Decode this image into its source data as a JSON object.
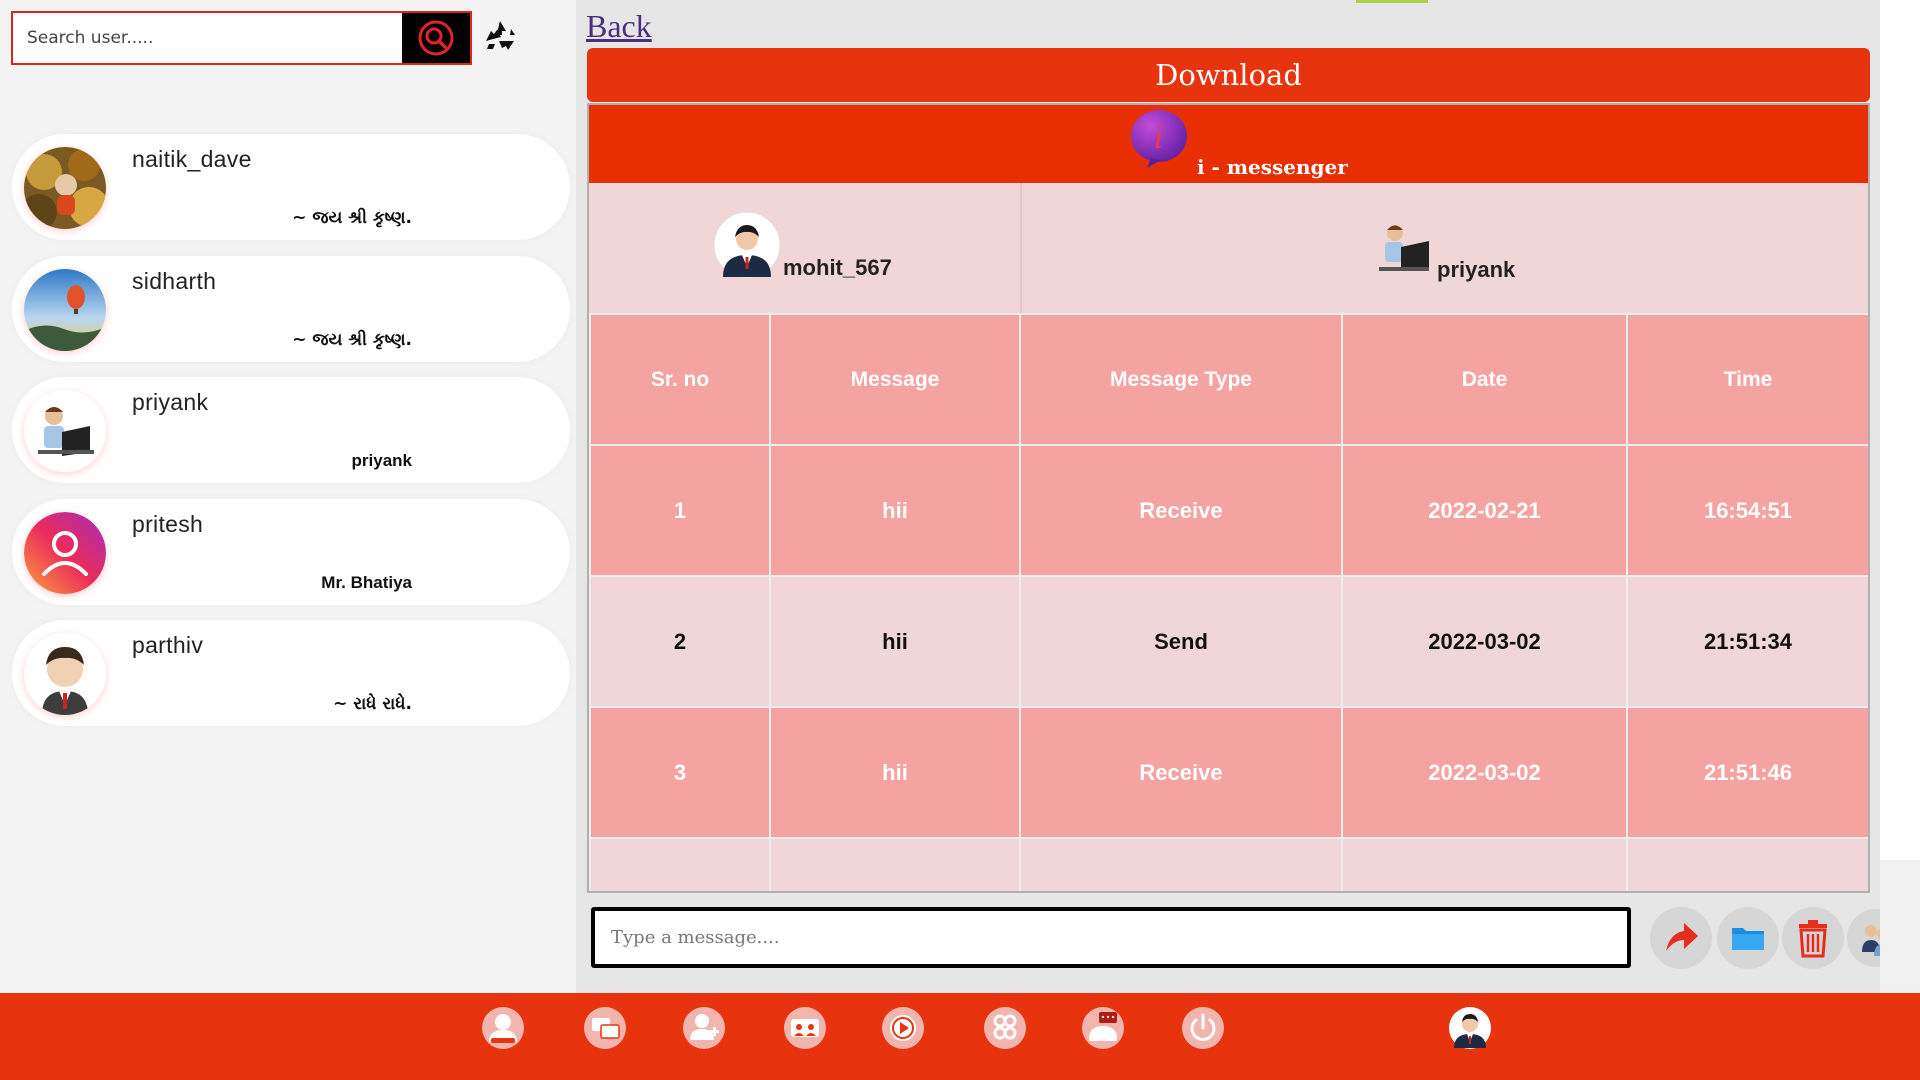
{
  "search": {
    "placeholder": "Search user....."
  },
  "contacts": [
    {
      "name": "naitik_dave",
      "status": "~ જય શ્રી કૃષ્ણ."
    },
    {
      "name": "sidharth",
      "status": "~ જય શ્રી કૃષ્ણ."
    },
    {
      "name": "priyank",
      "status": "priyank"
    },
    {
      "name": "pritesh",
      "status": "Mr. Bhatiya"
    },
    {
      "name": "parthiv",
      "status": "~ રાધે રાધે."
    }
  ],
  "main": {
    "back_label": "Back",
    "download_label": "Download",
    "brand_name": "i - messenger",
    "user_left": "mohit_567",
    "user_right": "priyank"
  },
  "table": {
    "headers": [
      "Sr. no",
      "Message",
      "Message Type",
      "Date",
      "Time"
    ],
    "rows": [
      {
        "sr": "1",
        "message": "hii",
        "type": "Receive",
        "date": "2022-02-21",
        "time": "16:54:51"
      },
      {
        "sr": "2",
        "message": "hii",
        "type": "Send",
        "date": "2022-03-02",
        "time": "21:51:34"
      },
      {
        "sr": "3",
        "message": "hii",
        "type": "Receive",
        "date": "2022-03-02",
        "time": "21:51:46"
      }
    ]
  },
  "composer": {
    "placeholder": "Type a message...."
  },
  "colors": {
    "accent": "#e8330f",
    "row_receive": "#f5a3a1",
    "row_send": "#f0d6d8"
  },
  "icons": [
    "search-icon",
    "recycle-icon",
    "send-arrow-icon",
    "folder-icon",
    "trash-icon",
    "users-icon"
  ],
  "nav_icons": [
    "profile-icon",
    "chats-icon",
    "add-user-icon",
    "groups-icon",
    "video-icon",
    "settings-icon",
    "notifications-icon",
    "power-icon",
    "account-avatar-icon"
  ]
}
